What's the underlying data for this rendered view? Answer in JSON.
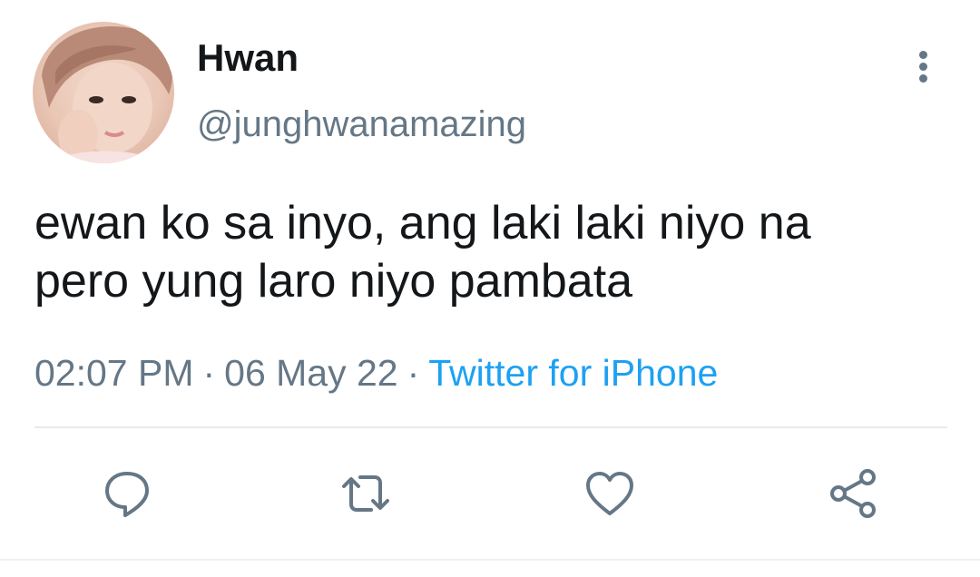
{
  "tweet": {
    "author": {
      "name": "Hwan",
      "handle": "@junghwanamazing"
    },
    "text_lines": [
      "ewan ko sa inyo, ang laki laki niyo na",
      "pero yung laro niyo pambata"
    ],
    "time": "02:07 PM",
    "date": "06 May 22",
    "separator": "·",
    "source": "Twitter for iPhone"
  },
  "actions": {
    "icons": [
      "reply-icon",
      "retweet-icon",
      "like-icon",
      "share-icon"
    ]
  },
  "colors": {
    "text_primary": "#14171a",
    "text_secondary": "#657786",
    "accent": "#1da1f2",
    "divider": "#e6ecf0"
  }
}
